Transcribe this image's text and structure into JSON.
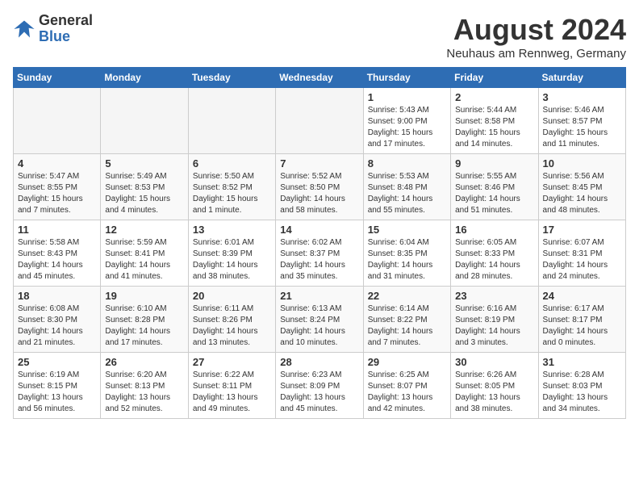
{
  "logo": {
    "general": "General",
    "blue": "Blue"
  },
  "title": "August 2024",
  "subtitle": "Neuhaus am Rennweg, Germany",
  "days_of_week": [
    "Sunday",
    "Monday",
    "Tuesday",
    "Wednesday",
    "Thursday",
    "Friday",
    "Saturday"
  ],
  "weeks": [
    [
      {
        "day": "",
        "info": "",
        "empty": true
      },
      {
        "day": "",
        "info": "",
        "empty": true
      },
      {
        "day": "",
        "info": "",
        "empty": true
      },
      {
        "day": "",
        "info": "",
        "empty": true
      },
      {
        "day": "1",
        "info": "Sunrise: 5:43 AM\nSunset: 9:00 PM\nDaylight: 15 hours and 17 minutes."
      },
      {
        "day": "2",
        "info": "Sunrise: 5:44 AM\nSunset: 8:58 PM\nDaylight: 15 hours and 14 minutes."
      },
      {
        "day": "3",
        "info": "Sunrise: 5:46 AM\nSunset: 8:57 PM\nDaylight: 15 hours and 11 minutes."
      }
    ],
    [
      {
        "day": "4",
        "info": "Sunrise: 5:47 AM\nSunset: 8:55 PM\nDaylight: 15 hours and 7 minutes."
      },
      {
        "day": "5",
        "info": "Sunrise: 5:49 AM\nSunset: 8:53 PM\nDaylight: 15 hours and 4 minutes."
      },
      {
        "day": "6",
        "info": "Sunrise: 5:50 AM\nSunset: 8:52 PM\nDaylight: 15 hours and 1 minute."
      },
      {
        "day": "7",
        "info": "Sunrise: 5:52 AM\nSunset: 8:50 PM\nDaylight: 14 hours and 58 minutes."
      },
      {
        "day": "8",
        "info": "Sunrise: 5:53 AM\nSunset: 8:48 PM\nDaylight: 14 hours and 55 minutes."
      },
      {
        "day": "9",
        "info": "Sunrise: 5:55 AM\nSunset: 8:46 PM\nDaylight: 14 hours and 51 minutes."
      },
      {
        "day": "10",
        "info": "Sunrise: 5:56 AM\nSunset: 8:45 PM\nDaylight: 14 hours and 48 minutes."
      }
    ],
    [
      {
        "day": "11",
        "info": "Sunrise: 5:58 AM\nSunset: 8:43 PM\nDaylight: 14 hours and 45 minutes."
      },
      {
        "day": "12",
        "info": "Sunrise: 5:59 AM\nSunset: 8:41 PM\nDaylight: 14 hours and 41 minutes."
      },
      {
        "day": "13",
        "info": "Sunrise: 6:01 AM\nSunset: 8:39 PM\nDaylight: 14 hours and 38 minutes."
      },
      {
        "day": "14",
        "info": "Sunrise: 6:02 AM\nSunset: 8:37 PM\nDaylight: 14 hours and 35 minutes."
      },
      {
        "day": "15",
        "info": "Sunrise: 6:04 AM\nSunset: 8:35 PM\nDaylight: 14 hours and 31 minutes."
      },
      {
        "day": "16",
        "info": "Sunrise: 6:05 AM\nSunset: 8:33 PM\nDaylight: 14 hours and 28 minutes."
      },
      {
        "day": "17",
        "info": "Sunrise: 6:07 AM\nSunset: 8:31 PM\nDaylight: 14 hours and 24 minutes."
      }
    ],
    [
      {
        "day": "18",
        "info": "Sunrise: 6:08 AM\nSunset: 8:30 PM\nDaylight: 14 hours and 21 minutes."
      },
      {
        "day": "19",
        "info": "Sunrise: 6:10 AM\nSunset: 8:28 PM\nDaylight: 14 hours and 17 minutes."
      },
      {
        "day": "20",
        "info": "Sunrise: 6:11 AM\nSunset: 8:26 PM\nDaylight: 14 hours and 13 minutes."
      },
      {
        "day": "21",
        "info": "Sunrise: 6:13 AM\nSunset: 8:24 PM\nDaylight: 14 hours and 10 minutes."
      },
      {
        "day": "22",
        "info": "Sunrise: 6:14 AM\nSunset: 8:22 PM\nDaylight: 14 hours and 7 minutes."
      },
      {
        "day": "23",
        "info": "Sunrise: 6:16 AM\nSunset: 8:19 PM\nDaylight: 14 hours and 3 minutes."
      },
      {
        "day": "24",
        "info": "Sunrise: 6:17 AM\nSunset: 8:17 PM\nDaylight: 14 hours and 0 minutes."
      }
    ],
    [
      {
        "day": "25",
        "info": "Sunrise: 6:19 AM\nSunset: 8:15 PM\nDaylight: 13 hours and 56 minutes."
      },
      {
        "day": "26",
        "info": "Sunrise: 6:20 AM\nSunset: 8:13 PM\nDaylight: 13 hours and 52 minutes."
      },
      {
        "day": "27",
        "info": "Sunrise: 6:22 AM\nSunset: 8:11 PM\nDaylight: 13 hours and 49 minutes."
      },
      {
        "day": "28",
        "info": "Sunrise: 6:23 AM\nSunset: 8:09 PM\nDaylight: 13 hours and 45 minutes."
      },
      {
        "day": "29",
        "info": "Sunrise: 6:25 AM\nSunset: 8:07 PM\nDaylight: 13 hours and 42 minutes."
      },
      {
        "day": "30",
        "info": "Sunrise: 6:26 AM\nSunset: 8:05 PM\nDaylight: 13 hours and 38 minutes."
      },
      {
        "day": "31",
        "info": "Sunrise: 6:28 AM\nSunset: 8:03 PM\nDaylight: 13 hours and 34 minutes."
      }
    ]
  ]
}
